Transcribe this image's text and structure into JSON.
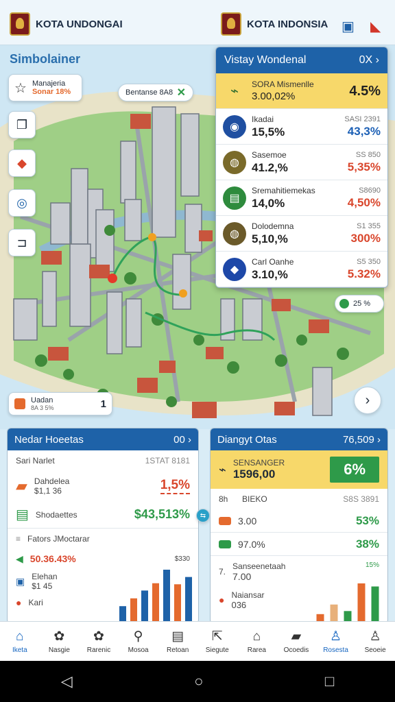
{
  "header": {
    "left_title": "KOTA UNDONGAI",
    "center_title": "KOTA INDONSIA"
  },
  "map": {
    "title": "Simbolainer",
    "badge_title": "Manajeria",
    "badge_value": "Sonar 18%",
    "chip_label": "Bentanse 8A8",
    "mini_card_title": "Uadan",
    "mini_card_sub": "8A 3 5%",
    "mini_card_value": "1",
    "green_pill": "25 %"
  },
  "panel": {
    "title": "Vistay Wondenal",
    "title_right": "0X",
    "top_row": {
      "label": "SORA Mismenlle",
      "value": "3.00,02%",
      "right": "4.5%"
    },
    "rows": [
      {
        "label": "Ikadai",
        "value": "15,5%",
        "right_top": "SASI 2391",
        "right": "43,3%",
        "color": "#1f4fa1",
        "right_color": "#1b5fb5"
      },
      {
        "label": "Sasemoe",
        "value": "41.2,%",
        "right_top": "SS 850",
        "right": "5,35%",
        "color": "#7a6a2a",
        "right_color": "#d9462c"
      },
      {
        "label": "Sremahitiemekas",
        "value": "14,0%",
        "right_top": "S8690",
        "right": "4,50%",
        "color": "#2e8b3d",
        "right_color": "#d9462c"
      },
      {
        "label": "Dolodemna",
        "value": "5,10,%",
        "right_top": "S1 355",
        "right": "300%",
        "color": "#6b5a2a",
        "right_color": "#d9462c"
      },
      {
        "label": "Carl Oanhe",
        "value": "3.10,%",
        "right_top": "S5 350",
        "right": "5.32%",
        "color": "#1e48a8",
        "right_color": "#d9462c"
      }
    ]
  },
  "left_card": {
    "title": "Nedar Hoeetas",
    "title_right": "00",
    "head_left": "Sari Narlet",
    "head_right": "1STAT 8181",
    "row1_label": "Dahdelea",
    "row1_sub": "$1,1 36",
    "row1_value": "1,5%",
    "row2_label": "Shodaettes",
    "row2_value": "$43,513%",
    "row3_label": "Fators JMoctarar",
    "row4_value": "50.36.43%",
    "row4_right": "$330",
    "row5_label": "Elehan",
    "row5_sub": "$1 45",
    "row6_label": "Kari",
    "bars": [
      {
        "value": 30,
        "color": "#1e62a8"
      },
      {
        "value": 45,
        "color": "#e46a2e"
      },
      {
        "value": 60,
        "color": "#1e62a8"
      },
      {
        "value": 74,
        "color": "#e46a2e"
      },
      {
        "value": 100,
        "color": "#1e62a8"
      },
      {
        "value": 72,
        "color": "#e46a2e"
      },
      {
        "value": 86,
        "color": "#1e62a8"
      }
    ]
  },
  "right_card": {
    "title": "Diangyt Otas",
    "title_right": "76,509",
    "top_label": "SENSANGER",
    "top_value": "1596,00",
    "top_badge": "6%",
    "head_left": "8h",
    "head_mid": "BIEKO",
    "head_right": "S8S 3891",
    "row1_value": "3.00",
    "row1_right": "53%",
    "row2_value": "97.0%",
    "row2_right": "38%",
    "row3_sub": "7.",
    "row3_label": "Sanseenetaah",
    "row3_value": "7.00",
    "row3_right": "15%",
    "row4_label": "Naiansar",
    "row4_value": "036",
    "bars": [
      {
        "value": 20,
        "color": "#e46a2e"
      },
      {
        "value": 45,
        "color": "#e8b07a"
      },
      {
        "value": 28,
        "color": "#2e9a49"
      },
      {
        "value": 100,
        "color": "#e46a2e"
      },
      {
        "value": 92,
        "color": "#2e9a49"
      }
    ]
  },
  "nav": [
    {
      "label": "Iketa",
      "icon": "home-icon",
      "active": true
    },
    {
      "label": "Nasgie",
      "icon": "gear-badge-icon",
      "active": false
    },
    {
      "label": "Rarenic",
      "icon": "gear-icon",
      "active": false
    },
    {
      "label": "Mosoa",
      "icon": "search-icon",
      "active": false
    },
    {
      "label": "Retoan",
      "icon": "document-icon",
      "active": false
    },
    {
      "label": "Siegute",
      "icon": "export-icon",
      "active": false
    },
    {
      "label": "Rarea",
      "icon": "building-icon",
      "active": false
    },
    {
      "label": "Ocoedis",
      "icon": "folder-icon",
      "active": false
    },
    {
      "label": "Rosesta",
      "icon": "user-active-icon",
      "active": true
    },
    {
      "label": "Seoeie",
      "icon": "user-icon",
      "active": false
    }
  ]
}
